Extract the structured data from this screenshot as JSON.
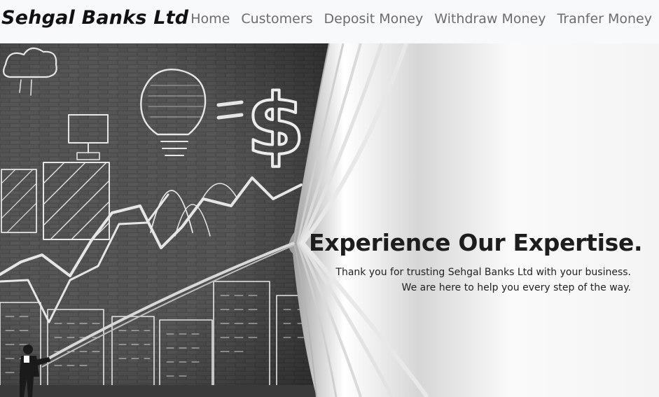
{
  "navbar": {
    "brand": "Sehgal Banks Ltd",
    "links": [
      {
        "label": "Home"
      },
      {
        "label": "Customers"
      },
      {
        "label": "Deposit Money"
      },
      {
        "label": "Withdraw Money"
      },
      {
        "label": "Tranfer Money"
      }
    ]
  },
  "hero": {
    "title": "Experience Our Expertise.",
    "line1": "Thank you for trusting Sehgal Banks Ltd with your business.",
    "line2": "We are here to help you every step of the way.",
    "chalk_sign": "$"
  },
  "colors": {
    "navbar_bg": "#f8f9fa",
    "brick": "#4a4a4a",
    "chalk": "#e8e8e8",
    "curtain": "#f5f5f5",
    "title": "#1d1d1d"
  }
}
